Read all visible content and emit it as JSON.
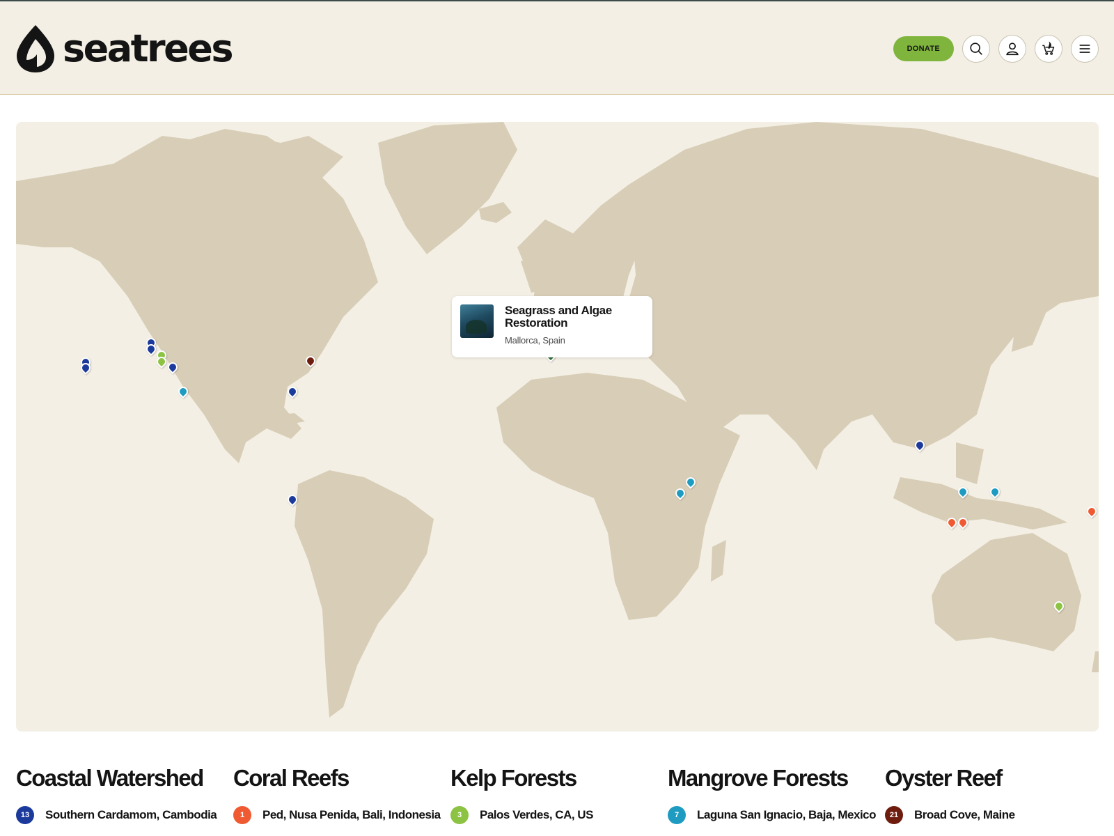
{
  "header": {
    "logo_text": "seatrees",
    "donate_label": "DONATE",
    "icons": [
      "search-icon",
      "account-icon",
      "cart-icon",
      "menu-icon"
    ]
  },
  "colors": {
    "background": "#f3efe4",
    "land": "#d8cdb6",
    "donate": "#7fb53d",
    "coastal_watershed": "#1c3a9b",
    "coral_reefs": "#f05a32",
    "kelp_forests": "#8cc342",
    "mangrove_forests": "#1e9bc0",
    "oyster_reef": "#6e1c0e",
    "seagrass": "#2e6b2e"
  },
  "map": {
    "tooltip": {
      "title": "Seagrass and Algae Restoration",
      "location": "Mallorca, Spain"
    },
    "pins": [
      {
        "type": "coastal_watershed",
        "name": "Hawaii pin 1"
      },
      {
        "type": "coastal_watershed",
        "name": "Hawaii pin 2"
      },
      {
        "type": "coastal_watershed",
        "name": "Northern California pin 1"
      },
      {
        "type": "coastal_watershed",
        "name": "Northern California pin 2"
      },
      {
        "type": "kelp_forests",
        "name": "Palos Verdes pin"
      },
      {
        "type": "kelp_forests",
        "name": "Southern California kelp pin"
      },
      {
        "type": "coastal_watershed",
        "name": "Inland California pin"
      },
      {
        "type": "mangrove_forests",
        "name": "Laguna San Ignacio pin"
      },
      {
        "type": "coastal_watershed",
        "name": "Florida pin"
      },
      {
        "type": "oyster_reef",
        "name": "Broad Cove pin"
      },
      {
        "type": "coastal_watershed",
        "name": "Ecuador pin"
      },
      {
        "type": "kelp_forests",
        "name": "Spain kelp pin"
      },
      {
        "type": "seagrass",
        "name": "Mallorca pin"
      },
      {
        "type": "mangrove_forests",
        "name": "Kenya pin 1"
      },
      {
        "type": "mangrove_forests",
        "name": "Kenya pin 2"
      },
      {
        "type": "coastal_watershed",
        "name": "Cambodia pin"
      },
      {
        "type": "mangrove_forests",
        "name": "Borneo pin"
      },
      {
        "type": "mangrove_forests",
        "name": "Sulawesi pin"
      },
      {
        "type": "coral_reefs",
        "name": "Bali pin 1"
      },
      {
        "type": "coral_reefs",
        "name": "Bali pin 2"
      },
      {
        "type": "coral_reefs",
        "name": "Pacific pin"
      },
      {
        "type": "kelp_forests",
        "name": "Australia pin"
      }
    ]
  },
  "categories": [
    {
      "title": "Coastal Watershed",
      "item": {
        "badge": "13",
        "label": "Southern Cardamom, Cambodia"
      }
    },
    {
      "title": "Coral Reefs",
      "item": {
        "badge": "1",
        "label": "Ped, Nusa Penida, Bali, Indonesia"
      }
    },
    {
      "title": "Kelp Forests",
      "item": {
        "badge": "3",
        "label": "Palos Verdes, CA, US"
      }
    },
    {
      "title": "Mangrove Forests",
      "item": {
        "badge": "7",
        "label": "Laguna San Ignacio, Baja, Mexico"
      }
    },
    {
      "title": "Oyster Reef",
      "item": {
        "badge": "21",
        "label": "Broad Cove, Maine"
      }
    }
  ]
}
